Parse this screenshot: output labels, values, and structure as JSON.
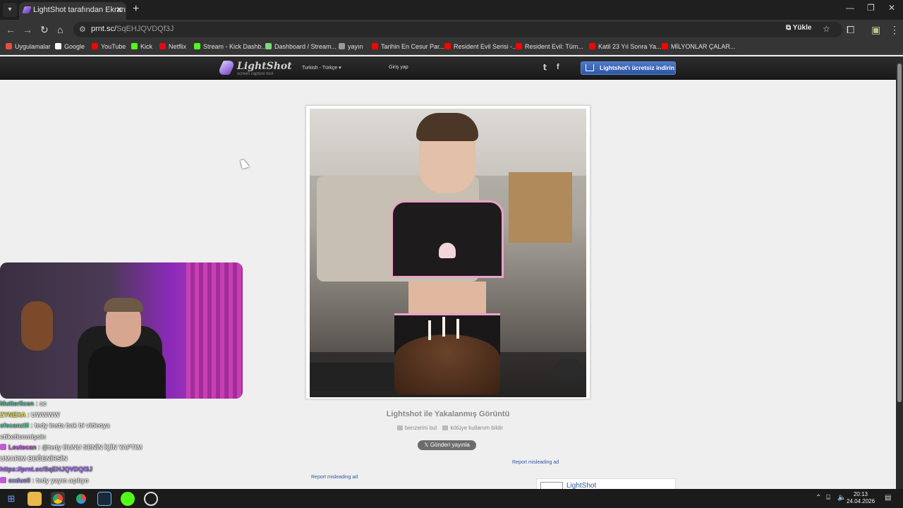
{
  "browser": {
    "tab_title": "LightShot tarafından Ekran Görü",
    "url_domain": "prnt.sc/",
    "url_path": "SqEHJQVDQf3J",
    "upload_label": "Yükle",
    "bookmarks": [
      {
        "label": "Uygulamalar",
        "color": "#e84d3d"
      },
      {
        "label": "Google",
        "color": "#ffffff"
      },
      {
        "label": "YouTube",
        "color": "#ff0000"
      },
      {
        "label": "Kick",
        "color": "#53fc18"
      },
      {
        "label": "Netflix",
        "color": "#e50914"
      },
      {
        "label": "Stream - Kick Dashb...",
        "color": "#53fc18"
      },
      {
        "label": "Dashboard / Stream...",
        "color": "#7fd67f"
      },
      {
        "label": "yayın",
        "color": "#999999"
      },
      {
        "label": "Tarihin En Cesur Par...",
        "color": "#ff0000"
      },
      {
        "label": "Resident Evil Serisi -...",
        "color": "#ff0000"
      },
      {
        "label": "Resident Evil: Tüm...",
        "color": "#ff0000"
      },
      {
        "label": "Katil 23 Yıl Sonra Ya...",
        "color": "#ff0000"
      },
      {
        "label": "MİLYONLAR ÇALAR...",
        "color": "#ff0000"
      }
    ]
  },
  "lightshot": {
    "logo_name": "LightShot",
    "logo_tagline": "screen capture tool",
    "language": "Turkish - Türkçe",
    "login": "Giriş yap",
    "download_button": "Lightshot'ı ücretsiz indirin",
    "caption": "Lightshot ile Yakalanmış Görüntü",
    "find_similar": "benzerini bul",
    "report_abuse": "kötüye kullanım bildir",
    "tweet_button": "Gönderi yayınla",
    "report_ad_1": "Report misleading ad",
    "report_ad_2": "Report misleading ad",
    "ad_name": "LightShot"
  },
  "chat": [
    {
      "user": "Mutterlicen",
      "msg": ": ac"
    },
    {
      "user": "ZYNEXA",
      "msg": ": UWWWW"
    },
    {
      "user": "efecanztll",
      "msg": ": tedy insta bak bi videoya"
    },
    {
      "user": "",
      "msg": "etiketlenmişsin"
    },
    {
      "user": "Leutecan",
      "msg": ": @tedy BUNU SENİN İÇİN YAPTIM"
    },
    {
      "user": "",
      "msg": "UMARIM BEĞENİRSİN"
    },
    {
      "user": "",
      "msg": "https://prnt.sc/SqEHJQVDQf3J"
    },
    {
      "user": "exduell",
      "msg": ": tedy yayın açılıyo"
    }
  ],
  "taskbar": {
    "time": "20:13",
    "date": "24.04.2026"
  },
  "colors": {
    "accent_blue": "#2d56a6",
    "page_bg": "#efefef",
    "header_bg": "#1a1a1a"
  }
}
